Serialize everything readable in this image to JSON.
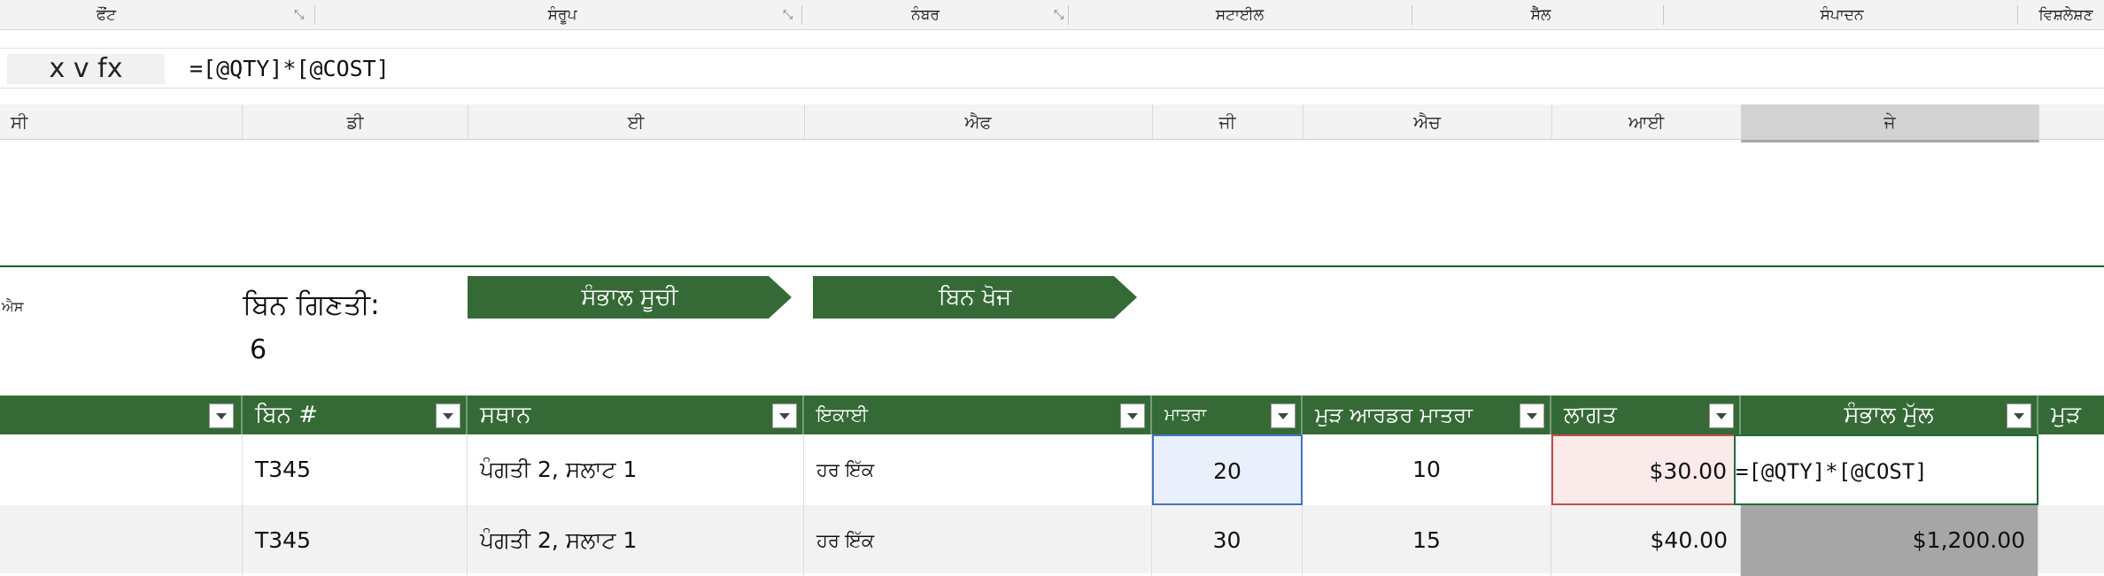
{
  "ribbon": {
    "groups": [
      "ਫੌਂਟ",
      "ਸੰਰੂਪ",
      "ਨੰਬਰ",
      "ਸਟਾਈਲ",
      "ਸੈੱਲ",
      "ਸੰਪਾਦਨ",
      "ਵਿਸ਼ਲੇਸ਼ਣ"
    ]
  },
  "formula_bar": {
    "name_box": "x v fx",
    "formula": "=[@QTY]*[@COST]"
  },
  "columns": {
    "headers": [
      "ਸੀ",
      "ਡੀ",
      "ਈ",
      "ਐਫ",
      "ਜੀ",
      "ਐਚ",
      "ਆਈ",
      "ਜੇ"
    ]
  },
  "info": {
    "side_label": "ਐਸ",
    "bin_count_label": "ਬਿਨ ਗਿਣਤੀ:",
    "bin_count_value": "6",
    "inventory_list_button": "ਸੰਭਾਲ ਸੂਚੀ",
    "bin_search_button": "ਬਿਨ ਖੋਜ"
  },
  "table": {
    "headers": [
      "ਬਿਨ #",
      "ਸਥਾਨ",
      "ਇਕਾਈ",
      "ਮਾਤਰਾ",
      "ਮੁੜ ਆਰਡਰ ਮਾਤਰਾ",
      "ਲਾਗਤ",
      "ਸੰਭਾਲ ਮੁੱਲ",
      "ਮੁੜ"
    ],
    "rows": [
      [
        "T345",
        "ਪੰਗਤੀ 2, ਸਲਾਟ 1",
        "ਹਰ ਇੱਕ",
        "20",
        "10",
        "$30.00",
        "=[@QTY]*[@COST]"
      ],
      [
        "T345",
        "ਪੰਗਤੀ 2, ਸਲਾਟ 1",
        "ਹਰ ਇੱਕ",
        "30",
        "15",
        "$40.00",
        "$1,200.00"
      ]
    ]
  },
  "colors": {
    "accent_green": "#356a36",
    "qty_highlight": "#eaf0fb",
    "cost_highlight": "#fbeaea",
    "value_fill": "#a6a6a6"
  }
}
